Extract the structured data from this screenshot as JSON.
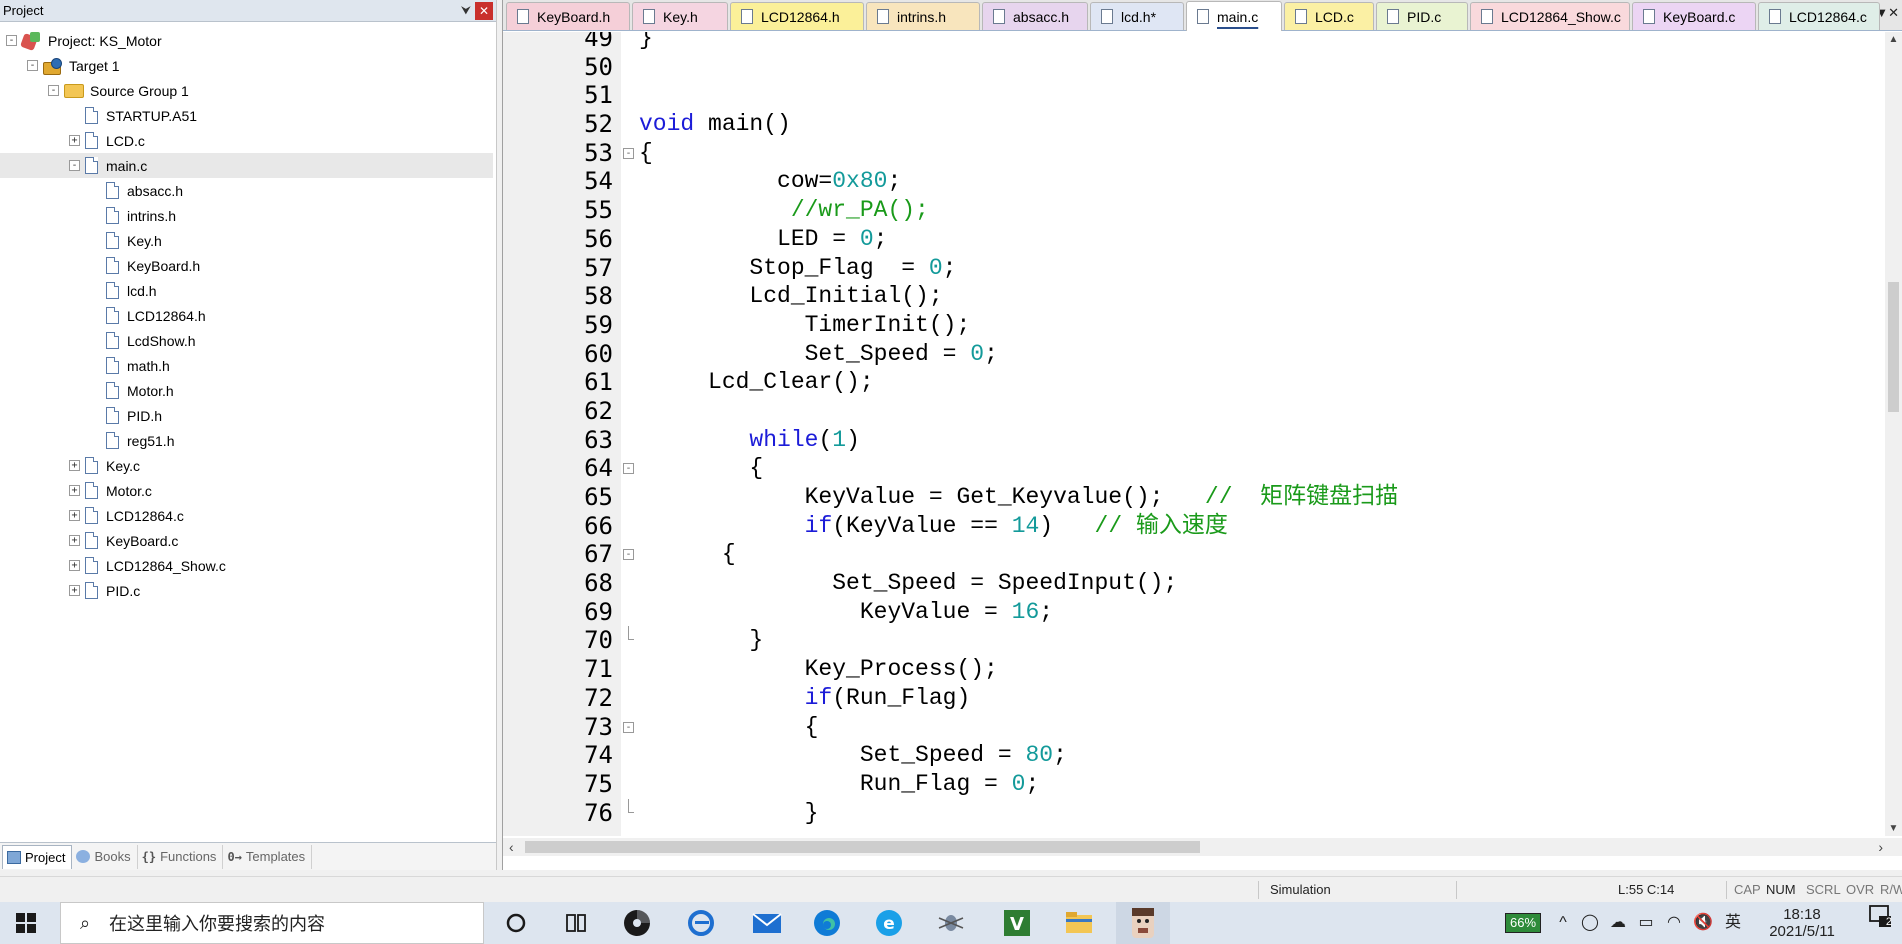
{
  "project_pane": {
    "title": "Project",
    "pin_glyph": "⮟",
    "close_glyph": "✕",
    "tree": [
      {
        "label": "Project: KS_Motor",
        "level": 0,
        "icon": "project",
        "expander": "-"
      },
      {
        "label": "Target 1",
        "level": 1,
        "icon": "target",
        "expander": "-"
      },
      {
        "label": "Source Group 1",
        "level": 2,
        "icon": "folder",
        "expander": "-"
      },
      {
        "label": "STARTUP.A51",
        "level": 3,
        "icon": "file",
        "expander": ""
      },
      {
        "label": "LCD.c",
        "level": 3,
        "icon": "file",
        "expander": "+"
      },
      {
        "label": "main.c",
        "level": 3,
        "icon": "file",
        "expander": "-",
        "selected": true
      },
      {
        "label": "absacc.h",
        "level": 4,
        "icon": "file",
        "expander": ""
      },
      {
        "label": "intrins.h",
        "level": 4,
        "icon": "file",
        "expander": ""
      },
      {
        "label": "Key.h",
        "level": 4,
        "icon": "file",
        "expander": ""
      },
      {
        "label": "KeyBoard.h",
        "level": 4,
        "icon": "file",
        "expander": ""
      },
      {
        "label": "lcd.h",
        "level": 4,
        "icon": "file",
        "expander": ""
      },
      {
        "label": "LCD12864.h",
        "level": 4,
        "icon": "file",
        "expander": ""
      },
      {
        "label": "LcdShow.h",
        "level": 4,
        "icon": "file",
        "expander": ""
      },
      {
        "label": "math.h",
        "level": 4,
        "icon": "file",
        "expander": ""
      },
      {
        "label": "Motor.h",
        "level": 4,
        "icon": "file",
        "expander": ""
      },
      {
        "label": "PID.h",
        "level": 4,
        "icon": "file",
        "expander": ""
      },
      {
        "label": "reg51.h",
        "level": 4,
        "icon": "file",
        "expander": ""
      },
      {
        "label": "Key.c",
        "level": 3,
        "icon": "file",
        "expander": "+"
      },
      {
        "label": "Motor.c",
        "level": 3,
        "icon": "file",
        "expander": "+"
      },
      {
        "label": "LCD12864.c",
        "level": 3,
        "icon": "file",
        "expander": "+"
      },
      {
        "label": "KeyBoard.c",
        "level": 3,
        "icon": "file",
        "expander": "+"
      },
      {
        "label": "LCD12864_Show.c",
        "level": 3,
        "icon": "file",
        "expander": "+"
      },
      {
        "label": "PID.c",
        "level": 3,
        "icon": "file",
        "expander": "+"
      }
    ],
    "bottom_tabs": [
      {
        "label": "Project",
        "icon": "project",
        "active": true
      },
      {
        "label": "Books",
        "icon": "books"
      },
      {
        "label": "Functions",
        "icon": "braces",
        "glyph": "{}"
      },
      {
        "label": "Templates",
        "icon": "braces",
        "glyph": "0→"
      }
    ]
  },
  "editor": {
    "tabs": [
      {
        "label": "KeyBoard.h",
        "color": "#f5cfd8"
      },
      {
        "label": "Key.h",
        "color": "#f5d5e1"
      },
      {
        "label": "LCD12864.h",
        "color": "#fbf099"
      },
      {
        "label": "intrins.h",
        "color": "#f8e5bd"
      },
      {
        "label": "absacc.h",
        "color": "#e7d5ee"
      },
      {
        "label": "lcd.h*",
        "color": "#dfe6f4"
      },
      {
        "label": "main.c",
        "color": "#ffffff",
        "active": true
      },
      {
        "label": "LCD.c",
        "color": "#fbf0a4"
      },
      {
        "label": "PID.c",
        "color": "#e9f3d2"
      },
      {
        "label": "LCD12864_Show.c",
        "color": "#f9d9dc"
      },
      {
        "label": "KeyBoard.c",
        "color": "#ecd5f4"
      },
      {
        "label": "LCD12864.c",
        "color": "#dfeee8"
      }
    ],
    "tab_overflow_glyph": "▼✕",
    "lines": [
      {
        "n": "49",
        "fold": "",
        "tokens": [
          {
            "t": "}",
            "c": ""
          }
        ]
      },
      {
        "n": "50",
        "fold": "",
        "tokens": []
      },
      {
        "n": "51",
        "fold": "",
        "tokens": []
      },
      {
        "n": "52",
        "fold": "",
        "tokens": [
          {
            "t": "void",
            "c": "kw"
          },
          {
            "t": " main()",
            "c": ""
          }
        ]
      },
      {
        "n": "53",
        "fold": "-",
        "tokens": [
          {
            "t": "{",
            "c": ""
          }
        ]
      },
      {
        "n": "54",
        "fold": "",
        "tokens": [
          {
            "t": "          cow=",
            "c": ""
          },
          {
            "t": "0x80",
            "c": "num"
          },
          {
            "t": ";",
            "c": ""
          }
        ]
      },
      {
        "n": "55",
        "fold": "",
        "tokens": [
          {
            "t": "           ",
            "c": ""
          },
          {
            "t": "//wr_PA();",
            "c": "cm"
          }
        ]
      },
      {
        "n": "56",
        "fold": "",
        "tokens": [
          {
            "t": "          LED = ",
            "c": ""
          },
          {
            "t": "0",
            "c": "num"
          },
          {
            "t": ";",
            "c": ""
          }
        ]
      },
      {
        "n": "57",
        "fold": "",
        "tokens": [
          {
            "t": "        Stop_Flag  = ",
            "c": ""
          },
          {
            "t": "0",
            "c": "num"
          },
          {
            "t": ";",
            "c": ""
          }
        ]
      },
      {
        "n": "58",
        "fold": "",
        "tokens": [
          {
            "t": "        Lcd_Initial();",
            "c": ""
          }
        ]
      },
      {
        "n": "59",
        "fold": "",
        "tokens": [
          {
            "t": "            TimerInit();",
            "c": ""
          }
        ]
      },
      {
        "n": "60",
        "fold": "",
        "tokens": [
          {
            "t": "            Set_Speed = ",
            "c": ""
          },
          {
            "t": "0",
            "c": "num"
          },
          {
            "t": ";",
            "c": ""
          }
        ]
      },
      {
        "n": "61",
        "fold": "",
        "tokens": [
          {
            "t": "     Lcd_Clear();",
            "c": ""
          }
        ]
      },
      {
        "n": "62",
        "fold": "",
        "tokens": []
      },
      {
        "n": "63",
        "fold": "",
        "tokens": [
          {
            "t": "        ",
            "c": ""
          },
          {
            "t": "while",
            "c": "kw"
          },
          {
            "t": "(",
            "c": ""
          },
          {
            "t": "1",
            "c": "num"
          },
          {
            "t": ")",
            "c": ""
          }
        ]
      },
      {
        "n": "64",
        "fold": "-",
        "tokens": [
          {
            "t": "        {",
            "c": ""
          }
        ]
      },
      {
        "n": "65",
        "fold": "",
        "tokens": [
          {
            "t": "            KeyValue = Get_Keyvalue();   ",
            "c": ""
          },
          {
            "t": "//  矩阵键盘扫描",
            "c": "cm"
          }
        ]
      },
      {
        "n": "66",
        "fold": "",
        "tokens": [
          {
            "t": "            ",
            "c": ""
          },
          {
            "t": "if",
            "c": "kw"
          },
          {
            "t": "(KeyValue == ",
            "c": ""
          },
          {
            "t": "14",
            "c": "num"
          },
          {
            "t": ")   ",
            "c": ""
          },
          {
            "t": "// 输入速度",
            "c": "cm"
          }
        ]
      },
      {
        "n": "67",
        "fold": "-",
        "tokens": [
          {
            "t": "      {",
            "c": ""
          }
        ]
      },
      {
        "n": "68",
        "fold": "",
        "tokens": [
          {
            "t": "              Set_Speed = SpeedInput();",
            "c": ""
          }
        ]
      },
      {
        "n": "69",
        "fold": "",
        "tokens": [
          {
            "t": "                KeyValue = ",
            "c": ""
          },
          {
            "t": "16",
            "c": "num"
          },
          {
            "t": ";",
            "c": ""
          }
        ]
      },
      {
        "n": "70",
        "fold": "end",
        "tokens": [
          {
            "t": "        }",
            "c": ""
          }
        ]
      },
      {
        "n": "71",
        "fold": "",
        "tokens": [
          {
            "t": "            Key_Process();",
            "c": ""
          }
        ]
      },
      {
        "n": "72",
        "fold": "",
        "tokens": [
          {
            "t": "            ",
            "c": ""
          },
          {
            "t": "if",
            "c": "kw"
          },
          {
            "t": "(Run_Flag)",
            "c": ""
          }
        ]
      },
      {
        "n": "73",
        "fold": "-",
        "tokens": [
          {
            "t": "            {",
            "c": ""
          }
        ]
      },
      {
        "n": "74",
        "fold": "",
        "tokens": [
          {
            "t": "                Set_Speed = ",
            "c": ""
          },
          {
            "t": "80",
            "c": "num"
          },
          {
            "t": ";",
            "c": ""
          }
        ]
      },
      {
        "n": "75",
        "fold": "",
        "tokens": [
          {
            "t": "                Run_Flag = ",
            "c": ""
          },
          {
            "t": "0",
            "c": "num"
          },
          {
            "t": ";",
            "c": ""
          }
        ]
      },
      {
        "n": "76",
        "fold": "end",
        "tokens": [
          {
            "t": "            }",
            "c": ""
          }
        ]
      }
    ]
  },
  "status_bar": {
    "mode": "Simulation",
    "cursor": "L:55 C:14",
    "caps": "CAP",
    "num": "NUM",
    "scrl": "SCRL",
    "ovr": "OVR",
    "rw": "R/W"
  },
  "taskbar": {
    "search_placeholder": "在这里输入你要搜索的内容",
    "battery": "66%",
    "ime": "英",
    "time": "18:18",
    "date": "2021/5/11",
    "notification_count": "2",
    "up_glyph": "^",
    "speaker_glyph": "🔇"
  },
  "colors": {
    "keyword": "#1c1cd8",
    "number": "#139a9a",
    "comment": "#1a9a1a"
  }
}
